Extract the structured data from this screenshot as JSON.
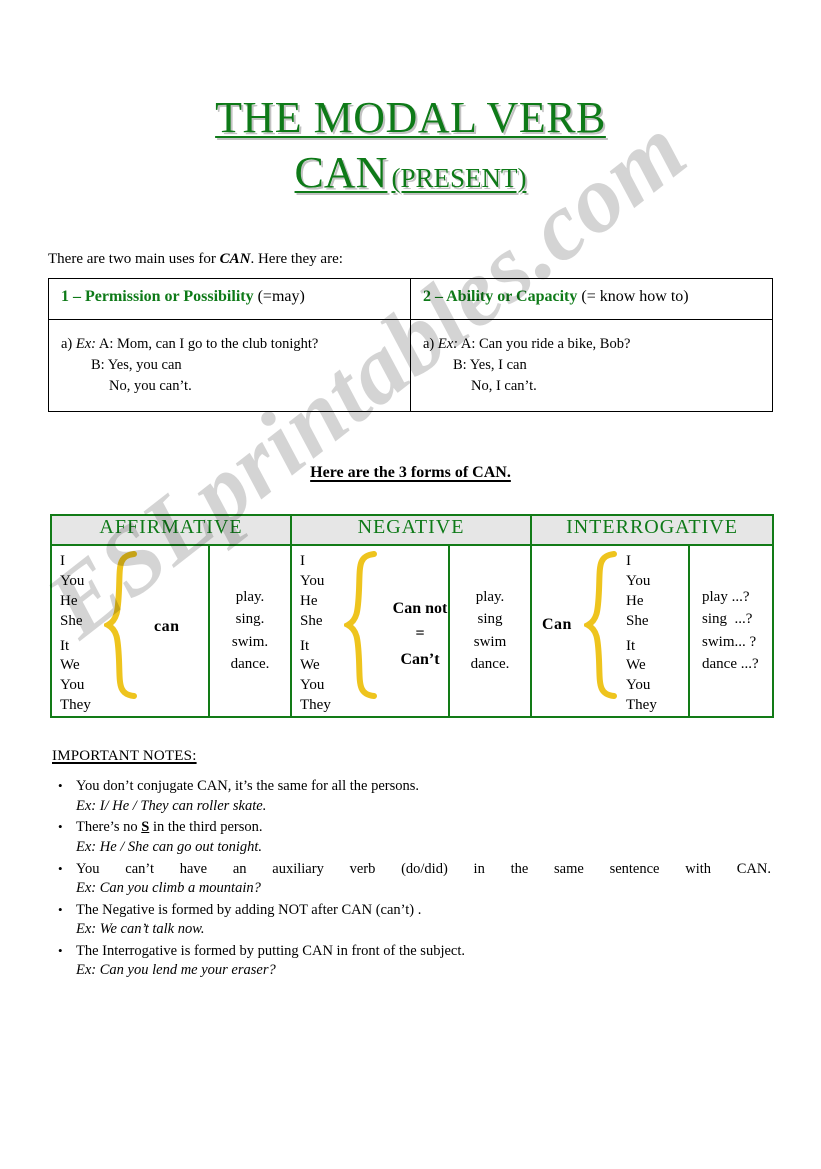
{
  "watermark": {
    "text": "ESLprintables.com"
  },
  "title": {
    "line1": "THE MODAL VERB",
    "line2_main": "CAN",
    "line2_sub": "(PRESENT)"
  },
  "intro": {
    "before": "There are two main uses for ",
    "emphasis": "CAN",
    "after": ". Here they are:"
  },
  "uses_table": {
    "columns": [
      {
        "heading_green": "1 – Permission or Possibility",
        "heading_black": "(=may)",
        "item_marker": "a)",
        "ex_label": "Ex:",
        "line_a": "A: Mom, can I go to the club tonight?",
        "line_b": "B:  Yes, you can",
        "line_c": "No, you can’t."
      },
      {
        "heading_green": "2 – Ability or Capacity",
        "heading_black": "(= know how to)",
        "item_marker": "a)",
        "ex_label": "Ex:",
        "line_a": "A: Can you ride a bike, Bob?",
        "line_b": "B:  Yes, I can",
        "line_c": "No, I can’t."
      }
    ]
  },
  "forms_heading": "Here are the 3 forms of CAN.",
  "forms_table": {
    "headers": [
      "AFFIRMATIVE",
      "NEGATIVE",
      "INTERROGATIVE"
    ],
    "pronouns_group1": [
      "I",
      "You",
      "He",
      "She"
    ],
    "pronouns_group2": [
      "It",
      "We",
      "You",
      "They"
    ],
    "affirmative": {
      "modal": "can",
      "verbs": [
        "play.",
        "sing.",
        "swim.",
        "dance."
      ]
    },
    "negative": {
      "modal_line1": "Can not",
      "modal_line2": "=",
      "modal_line3": "Can’t",
      "verbs": [
        "play.",
        "sing",
        "swim",
        "dance."
      ]
    },
    "interrogative": {
      "modal": "Can",
      "verbs": [
        "play ...?",
        "sing  ...?",
        "swim... ?",
        "dance ...?"
      ]
    }
  },
  "notes": {
    "title": "IMPORTANT NOTES:",
    "items": [
      {
        "main_before": "You don’t conjugate CAN, it’s the same for all the persons.",
        "underlined": "",
        "main_after": "",
        "ex_label": "Ex: ",
        "ex_text": "I/ He / They can roller skate."
      },
      {
        "main_before": "There’s no ",
        "underlined": "S",
        "main_after": " in the third person.",
        "ex_label": "Ex: ",
        "ex_text": "He / She can go out tonight."
      },
      {
        "main_before": "You can’t have an auxiliary verb (do/did) in the same sentence with CAN.",
        "underlined": "",
        "main_after": "",
        "ex_label": "Ex: ",
        "ex_text": "Can you climb a mountain?"
      },
      {
        "main_before": "The Negative is formed by adding NOT after CAN (can’t) .",
        "underlined": "",
        "main_after": "",
        "ex_label": "Ex: ",
        "ex_text": "We can’t talk now."
      },
      {
        "main_before": "The Interrogative is formed by putting CAN in front of the subject.",
        "underlined": "",
        "main_after": "",
        "ex_label": "Ex: ",
        "ex_text": "Can you lend me your eraser?"
      }
    ]
  },
  "colors": {
    "green": "#0E7A18",
    "table_border_green": "#127B17",
    "brace_gold": "#EEC41E",
    "header_fill": "#E6E6E6"
  }
}
